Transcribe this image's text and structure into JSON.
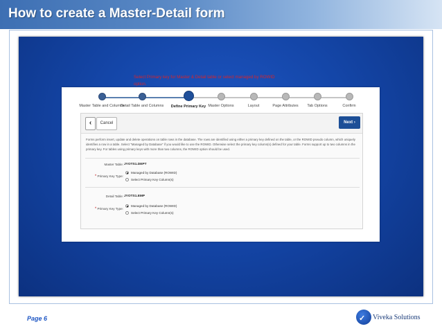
{
  "slide": {
    "title": "How to create a Master-Detail form",
    "page": "Page 6",
    "brand": "Viveka Solutions"
  },
  "wizard": {
    "steps": [
      {
        "label": "Master Table and Columns",
        "state": "done"
      },
      {
        "label": "Detail Table and Columns",
        "state": "done"
      },
      {
        "label": "Define Primary Key",
        "state": "current"
      },
      {
        "label": "Master Options",
        "state": "todo"
      },
      {
        "label": "Layout",
        "state": "todo"
      },
      {
        "label": "Page Attributes",
        "state": "todo"
      },
      {
        "label": "Tab Options",
        "state": "todo"
      },
      {
        "label": "Confirm",
        "state": "todo"
      }
    ],
    "back_icon": "‹",
    "cancel_label": "Cancel",
    "next_label": "Next ›"
  },
  "form": {
    "description": "Forms perform insert, update and delete operations on table rows in the database. The rows are identified using either a primary key defined on the table, or the ROWID pseudo column, which uniquely identifies a row in a table. Select \"Managed by Database\" if you would like to use the ROWID. Otherwise select the primary key column(s) defined for your table. Forms support up to two columns in the primary key. For tables using primary keys with more than two columns, the ROWID option should be used.",
    "master": {
      "table_label": "Master Table:",
      "table_value": "JYOTS1.DEPT",
      "pk_label": "Primary Key Type:",
      "options": [
        "Managed by Database (ROWID)",
        "Select Primary Key Column(s)"
      ],
      "selected": 0
    },
    "detail": {
      "table_label": "Detail Table:",
      "table_value": "JYOTS1.EMP",
      "pk_label": "Primary Key Type:",
      "options": [
        "Managed by Database (ROWID)",
        "Select Primary Key Column(s)"
      ],
      "selected": 0
    }
  },
  "annotation": "Select Primary key for Master & Detail table or select managed by ROWID option.",
  "colors": {
    "accent": "#1d4f97",
    "annotation": "#d8242a",
    "background": "#1446a8"
  }
}
